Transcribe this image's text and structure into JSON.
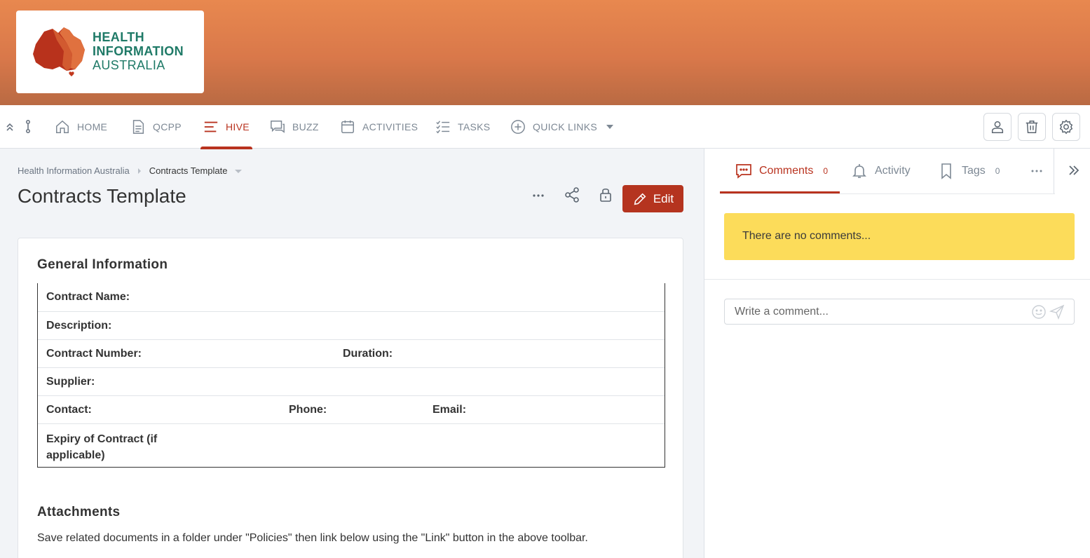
{
  "logo": {
    "line1": "HEALTH",
    "line2": "INFORMATION",
    "line3": "AUSTRALIA"
  },
  "nav": {
    "items": [
      {
        "label": "HOME",
        "icon": "home-icon"
      },
      {
        "label": "QCPP",
        "icon": "document-icon"
      },
      {
        "label": "HIVE",
        "icon": "lines-icon",
        "active": true
      },
      {
        "label": "BUZZ",
        "icon": "chat-icon"
      },
      {
        "label": "ACTIVITIES",
        "icon": "calendar-icon"
      },
      {
        "label": "TASKS",
        "icon": "checklist-icon"
      },
      {
        "label": "QUICK LINKS",
        "icon": "plus-circle-icon"
      }
    ],
    "right_buttons": [
      "user-icon",
      "trash-icon",
      "gear-icon"
    ]
  },
  "breadcrumb": {
    "parent": "Health Information Australia",
    "current": "Contracts Template"
  },
  "page": {
    "title": "Contracts Template",
    "edit_label": "Edit"
  },
  "general": {
    "heading": "General Information",
    "fields": {
      "contract_name": "Contract Name:",
      "description": "Description:",
      "contract_number": "Contract Number:",
      "duration": "Duration:",
      "supplier": "Supplier:",
      "contact": "Contact:",
      "phone": "Phone:",
      "email": "Email:",
      "expiry": "Expiry of Contract (if applicable)"
    }
  },
  "attachments": {
    "heading": "Attachments",
    "text": "Save related documents in a folder under \"Policies\" then link below using the \"Link\" button in the above toolbar."
  },
  "side": {
    "tabs": [
      {
        "label": "Comments",
        "count": "0",
        "active": true
      },
      {
        "label": "Activity"
      },
      {
        "label": "Tags",
        "count": "0"
      }
    ],
    "no_comments": "There are no comments...",
    "comment_placeholder": "Write a comment..."
  },
  "colors": {
    "accent": "#b5341f",
    "banner": "#d9784a",
    "notice": "#fcdc5a",
    "logo_text": "#1f7a67"
  }
}
